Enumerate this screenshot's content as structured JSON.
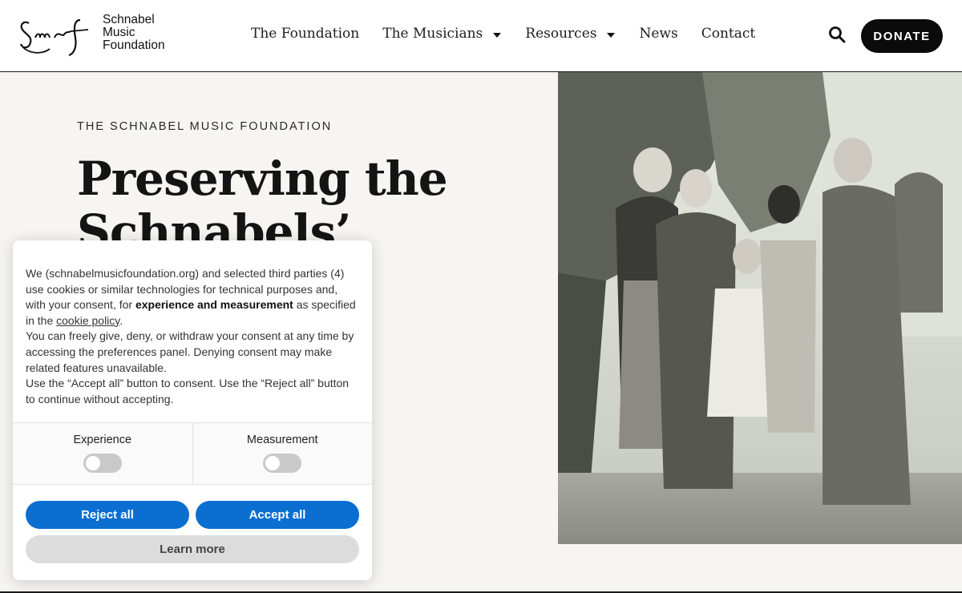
{
  "logo": {
    "lines": [
      "Schnabel",
      "Music",
      "Foundation"
    ]
  },
  "nav": [
    {
      "label": "The Foundation",
      "dropdown": false
    },
    {
      "label": "The Musicians",
      "dropdown": true
    },
    {
      "label": "Resources",
      "dropdown": true
    },
    {
      "label": "News",
      "dropdown": false
    },
    {
      "label": "Contact",
      "dropdown": false
    }
  ],
  "header": {
    "donate_label": "DONATE",
    "search_icon": "search-icon"
  },
  "hero": {
    "eyebrow": "THE SCHNABEL MUSIC FOUNDATION",
    "title": "Preserving the Schnabels’ musical"
  },
  "cookie": {
    "p1_a": "We (schnabelmusicfoundation.org) and selected third parties (4) use cookies or similar technologies for technical purposes and, with your consent, for ",
    "p1_bold": "experience and measurement",
    "p1_b": " as specified in the ",
    "p1_link": "cookie policy",
    "p1_c": ".",
    "p2": "You can freely give, deny, or withdraw your consent at any time by accessing the preferences panel. Denying consent may make related features unavailable.",
    "p3": "Use the “Accept all” button to consent. Use the “Reject all” button to continue without accepting.",
    "prefs": [
      {
        "label": "Experience",
        "enabled": false
      },
      {
        "label": "Measurement",
        "enabled": false
      }
    ],
    "reject_label": "Reject all",
    "accept_label": "Accept all",
    "learn_label": "Learn more"
  },
  "colors": {
    "accent": "#0a6fd0",
    "donate_bg": "#0b0b0b",
    "page_bg": "#f6f5f1"
  }
}
